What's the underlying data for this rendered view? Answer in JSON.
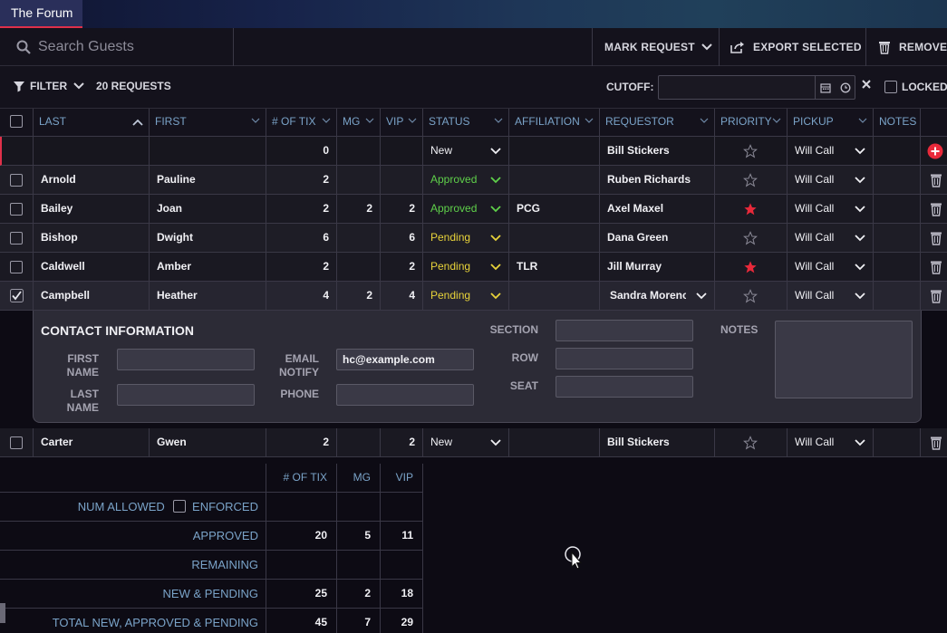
{
  "window": {
    "tab_title": "The Forum"
  },
  "toolbar": {
    "search_placeholder": "Search Guests",
    "mark_request": "MARK REQUEST",
    "export_selected": "EXPORT SELECTED",
    "remove": "REMOVE"
  },
  "filterbar": {
    "filter_label": "FILTER",
    "request_count": "20 REQUESTS",
    "cutoff_label": "CUTOFF:",
    "locked_label": "LOCKED"
  },
  "columns": {
    "last": "LAST",
    "first": "FIRST",
    "tix": "# OF TIX",
    "mg": "MG",
    "vip": "VIP",
    "status": "STATUS",
    "affiliation": "AFFILIATION",
    "requestor": "REQUESTOR",
    "priority": "PRIORITY",
    "pickup": "PICKUP",
    "notes": "NOTES"
  },
  "new_row": {
    "tix": "0",
    "status": "New",
    "requestor": "Bill Stickers",
    "pickup": "Will Call"
  },
  "rows": [
    {
      "last": "Arnold",
      "first": "Pauline",
      "tix": "2",
      "mg": "",
      "vip": "",
      "status": "Approved",
      "affiliation": "",
      "requestor": "Ruben Richards",
      "priority": false,
      "pickup": "Will Call",
      "checked": false
    },
    {
      "last": "Bailey",
      "first": "Joan",
      "tix": "2",
      "mg": "2",
      "vip": "2",
      "status": "Approved",
      "affiliation": "PCG",
      "requestor": "Axel Maxel",
      "priority": true,
      "pickup": "Will Call",
      "checked": false
    },
    {
      "last": "Bishop",
      "first": "Dwight",
      "tix": "6",
      "mg": "",
      "vip": "6",
      "status": "Pending",
      "affiliation": "",
      "requestor": "Dana Green",
      "priority": false,
      "pickup": "Will Call",
      "checked": false
    },
    {
      "last": "Caldwell",
      "first": "Amber",
      "tix": "2",
      "mg": "",
      "vip": "2",
      "status": "Pending",
      "affiliation": "TLR",
      "requestor": "Jill Murray",
      "priority": true,
      "pickup": "Will Call",
      "checked": false
    },
    {
      "last": "Campbell",
      "first": "Heather",
      "tix": "4",
      "mg": "2",
      "vip": "4",
      "status": "Pending",
      "affiliation": "",
      "requestor": "Sandra Morenc",
      "priority": false,
      "pickup": "Will Call",
      "checked": true
    },
    {
      "last": "Carter",
      "first": "Gwen",
      "tix": "2",
      "mg": "",
      "vip": "2",
      "status": "New",
      "affiliation": "",
      "requestor": "Bill Stickers",
      "priority": false,
      "pickup": "Will Call",
      "checked": false
    }
  ],
  "contact": {
    "title": "CONTACT INFORMATION",
    "first_name_label": "FIRST NAME",
    "last_name_label": "LAST NAME",
    "email_label": "EMAIL NOTIFY",
    "email_value": "hc@example.com",
    "phone_label": "PHONE",
    "section_label": "SECTION",
    "row_label": "ROW",
    "seat_label": "SEAT",
    "notes_label": "NOTES"
  },
  "summary": {
    "col_tix": "# OF TIX",
    "col_mg": "MG",
    "col_vip": "VIP",
    "num_allowed": "NUM ALLOWED",
    "enforced": "ENFORCED",
    "approved": {
      "label": "APPROVED",
      "tix": "20",
      "mg": "5",
      "vip": "11"
    },
    "remaining": {
      "label": "REMAINING"
    },
    "new_pending": {
      "label": "NEW & PENDING",
      "tix": "25",
      "mg": "2",
      "vip": "18"
    },
    "total": {
      "label": "TOTAL NEW, APPROVED & PENDING",
      "tix": "45",
      "mg": "7",
      "vip": "29"
    }
  },
  "colors": {
    "approved": "#5fd04a",
    "pending": "#e8d33a",
    "star_active": "#e8293a",
    "header_text": "#7aa3c8"
  }
}
